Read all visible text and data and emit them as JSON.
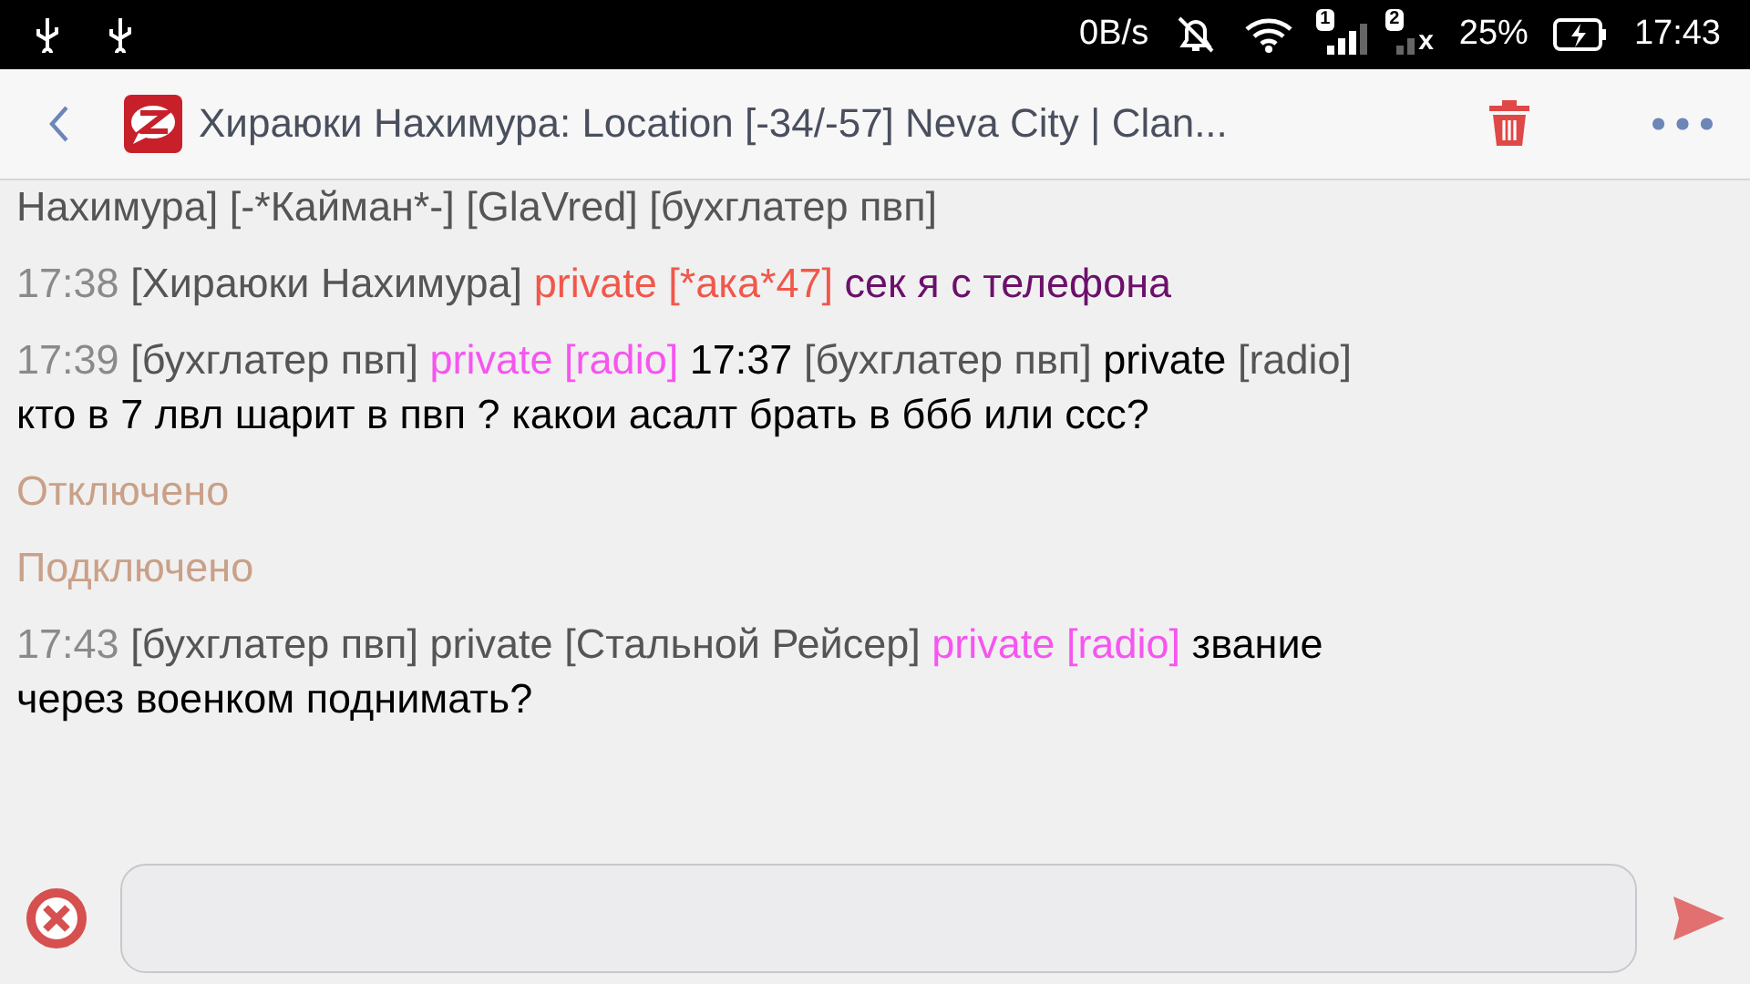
{
  "status_bar": {
    "speed": "0B/s",
    "sim_1": "1",
    "sim_2": "2",
    "sim_2_mark": "x",
    "battery": "25%",
    "time": "17:43"
  },
  "header": {
    "title": "Хираюки Нахимура:  Location [-34/-57] Neva City | Clan..."
  },
  "messages": [
    {
      "lines": [
        [
          {
            "text": "Нахимура] [-*Кайман*-] [GlaVred] [бухглатер пвп]",
            "color": "#555555"
          }
        ]
      ]
    },
    {
      "lines": [
        [
          {
            "text": "17:38",
            "color": "#8a8a8a"
          },
          {
            "text": "[Хираюки Нахимура]",
            "color": "#555555"
          },
          {
            "text": "private [*ака*47]",
            "color": "#f0584a"
          },
          {
            "text": "сек я с телефона",
            "color": "#6c0f6c"
          }
        ]
      ]
    },
    {
      "lines": [
        [
          {
            "text": "17:39",
            "color": "#8a8a8a"
          },
          {
            "text": "[бухглатер пвп]",
            "color": "#555555"
          },
          {
            "text": "private [radio]",
            "color": "#f655f0"
          },
          {
            "text": "17:37",
            "color": "#000000"
          },
          {
            "text": "[бухглатер пвп]",
            "color": "#555555"
          },
          {
            "text": "private",
            "color": "#000000"
          },
          {
            "text": "[radio]",
            "color": "#555555"
          }
        ],
        [
          {
            "text": "кто в 7 лвл шарит в пвп ? какои асалт брать в ббб или ссс?",
            "color": "#000000"
          }
        ]
      ]
    },
    {
      "lines": [
        [
          {
            "text": "Отключено",
            "color": "#c9a088"
          }
        ]
      ]
    },
    {
      "lines": [
        [
          {
            "text": "Подключено",
            "color": "#c9a088"
          }
        ]
      ]
    },
    {
      "lines": [
        [
          {
            "text": "17:43",
            "color": "#8a8a8a"
          },
          {
            "text": "[бухглатер пвп]",
            "color": "#555555"
          },
          {
            "text": "private",
            "color": "#555555"
          },
          {
            "text": "[Стальной Рейсер]",
            "color": "#555555"
          },
          {
            "text": "private [radio]",
            "color": "#f655f0"
          },
          {
            "text": "звание",
            "color": "#000000"
          }
        ],
        [
          {
            "text": "через военком поднимать?",
            "color": "#000000"
          }
        ]
      ]
    }
  ]
}
